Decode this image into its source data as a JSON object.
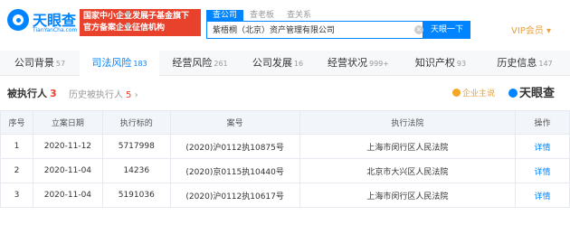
{
  "brand": {
    "name": "天眼查",
    "domain": "TianYanCha.com",
    "badge_line1": "国家中小企业发展子基金旗下",
    "badge_line2": "官方备案企业征信机构"
  },
  "search": {
    "tabs": [
      "查公司",
      "查老板",
      "查关系"
    ],
    "value": "紫梧桐（北京）资产管理有限公司",
    "clear": "×",
    "button": "天眼一下"
  },
  "vip": {
    "label": "VIP会员",
    "arrow": "▾"
  },
  "nav": [
    {
      "label": "公司背景",
      "count": "57",
      "active": false
    },
    {
      "label": "司法风险",
      "count": "183",
      "active": true
    },
    {
      "label": "经营风险",
      "count": "261",
      "active": false
    },
    {
      "label": "公司发展",
      "count": "16",
      "active": false
    },
    {
      "label": "经营状况",
      "count": "999+",
      "active": false
    },
    {
      "label": "知识产权",
      "count": "93",
      "active": false
    },
    {
      "label": "历史信息",
      "count": "147",
      "active": false
    }
  ],
  "section": {
    "title": "被执行人",
    "count": "3",
    "history_label": "历史被执行人",
    "history_count": "5",
    "history_arrow": "›",
    "mainsou": "企业主说",
    "logo": "天眼查"
  },
  "table": {
    "headers": [
      "序号",
      "立案日期",
      "执行标的",
      "案号",
      "执行法院",
      "操作"
    ],
    "rows": [
      [
        "1",
        "2020-11-12",
        "5717998",
        "(2020)沪0112执10875号",
        "上海市闵行区人民法院",
        "详情"
      ],
      [
        "2",
        "2020-11-04",
        "14236",
        "(2020)京0115执10440号",
        "北京市大兴区人民法院",
        "详情"
      ],
      [
        "3",
        "2020-11-04",
        "5191036",
        "(2020)沪0112执10617号",
        "上海市闵行区人民法院",
        "详情"
      ]
    ]
  },
  "colors": {
    "accent": "#0084ff",
    "danger": "#e8412c",
    "vip": "#e8a23a"
  }
}
